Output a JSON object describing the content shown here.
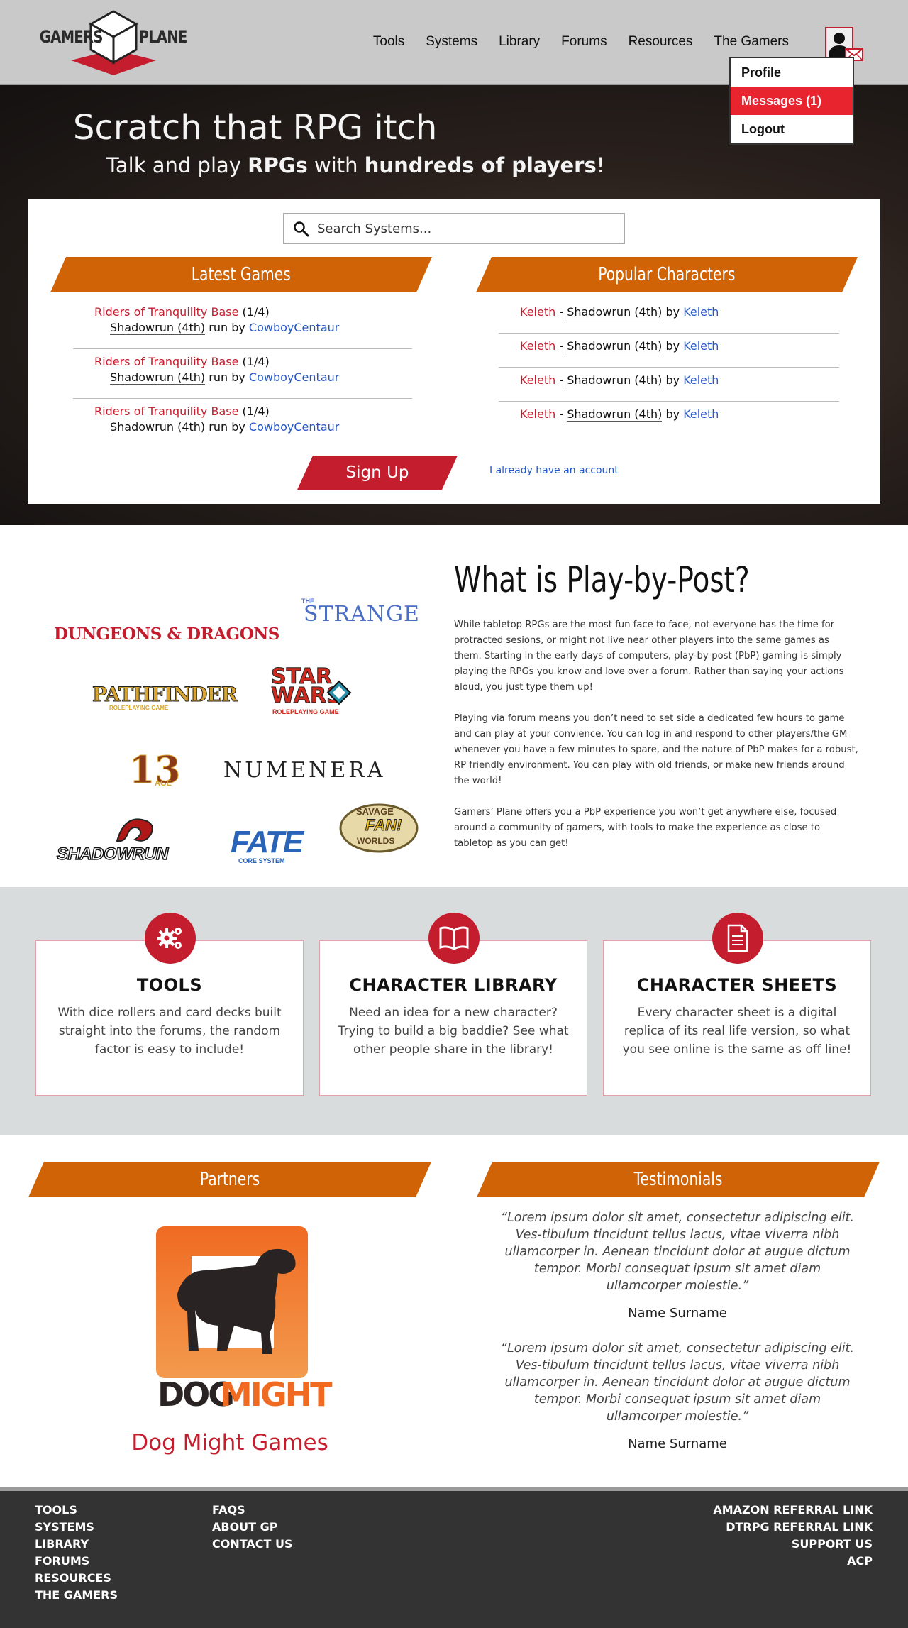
{
  "header": {
    "logo_left": "GAMERS",
    "logo_right": "PLANE",
    "nav": [
      "Tools",
      "Systems",
      "Library",
      "Forums",
      "Resources",
      "The Gamers"
    ],
    "user_menu": [
      "Profile",
      "Messages (1)",
      "Logout"
    ]
  },
  "hero": {
    "title": "Scratch that RPG itch",
    "subtitle_pre": "Talk and play ",
    "subtitle_b1": "RPGs",
    "subtitle_mid": " with ",
    "subtitle_b2": "hundreds of players",
    "subtitle_post": "!",
    "search_placeholder": "Search Systems...",
    "latest_title": "Latest Games",
    "popular_title": "Popular Characters",
    "games": [
      {
        "name": "Riders of Tranquility Base",
        "count": "(1/4)",
        "system": "Shadowrun (4th)",
        "run_by": "run by",
        "gm": "CowboyCentaur"
      },
      {
        "name": "Riders of Tranquility Base",
        "count": "(1/4)",
        "system": "Shadowrun (4th)",
        "run_by": "run by",
        "gm": "CowboyCentaur"
      },
      {
        "name": "Riders of Tranquility Base",
        "count": "(1/4)",
        "system": "Shadowrun (4th)",
        "run_by": "run by",
        "gm": "CowboyCentaur"
      }
    ],
    "characters": [
      {
        "name": "Keleth",
        "sep": "-",
        "system": "Shadowrun (4th)",
        "by": "by",
        "owner": "Keleth"
      },
      {
        "name": "Keleth",
        "sep": "-",
        "system": "Shadowrun (4th)",
        "by": "by",
        "owner": "Keleth"
      },
      {
        "name": "Keleth",
        "sep": "-",
        "system": "Shadowrun (4th)",
        "by": "by",
        "owner": "Keleth"
      },
      {
        "name": "Keleth",
        "sep": "-",
        "system": "Shadowrun (4th)",
        "by": "by",
        "owner": "Keleth"
      }
    ],
    "signup_label": "Sign Up",
    "have_account_label": "I already have an account"
  },
  "logos": {
    "dnd": "DUNGEONS & DRAGONS",
    "strange_small": "THE",
    "strange": "STRANGE",
    "pathfinder": "PATHFINDER",
    "pathfinder_sub": "ROLEPLAYING GAME",
    "starwars": "STAR WARS",
    "starwars_sub": "ROLEPLAYING GAME",
    "age13": "13",
    "age13_sub": "AGE",
    "numenera": "NUMENERA",
    "savage": "SAVAGE",
    "savage_fan": "FAN!",
    "savage_sub": "WORLDS",
    "shadowrun": "SHADOWRUN",
    "fate": "FATE",
    "fate_sub": "CORE SYSTEM"
  },
  "pbp": {
    "title": "What is Play-by-Post?",
    "paragraphs": [
      "While tabletop RPGs are the most fun face to face, not everyone has the time for protracted sesions, or might not live near other players into the same games as them. Starting in the early days of computers, play-by-post (PbP) gaming is simply playing the RPGs you know and love over a forum. Rather than saying your actions aloud, you just type them up!",
      "Playing via forum means you don’t need to set side a dedicated few hours to game and can play at your convience. You can log in and respond to other players/the GM whenever you have a few minutes to spare, and the nature of PbP makes for a robust, RP friendly environment. You can play with old friends, or make new friends around the world!",
      "Gamers’ Plane offers you a PbP experience you won’t get anywhere else, focused around a community of gamers, with tools to make the experience as close to tabletop as you can get!"
    ]
  },
  "features": [
    {
      "icon": "gears-icon",
      "title": "TOOLS",
      "text": "With dice rollers and card decks built straight into the forums, the random factor is easy to include!"
    },
    {
      "icon": "book-icon",
      "title": "CHARACTER LIBRARY",
      "text": "Need an idea for a new character? Trying to build a big baddie? See what other people share in the library!"
    },
    {
      "icon": "document-icon",
      "title": "CHARACTER SHEETS",
      "text": "Every character sheet is a digital replica of its real life version, so what you see online is the same as off line!"
    }
  ],
  "partners": {
    "title": "Partners",
    "logo_dog": "DOG",
    "logo_might": "MIGHT",
    "name": "Dog Might Games"
  },
  "testimonials": {
    "title": "Testimonials",
    "items": [
      {
        "quote": "“Lorem ipsum dolor sit amet, consectetur adipiscing elit. Ves-tibulum tincidunt tellus lacus, vitae viverra nibh ullamcorper in. Aenean tincidunt dolor at augue dictum tempor. Morbi consequat ipsum sit amet diam ullamcorper molestie.”",
        "name": "Name Surname"
      },
      {
        "quote": "“Lorem ipsum dolor sit amet, consectetur adipiscing elit. Ves-tibulum tincidunt tellus lacus, vitae viverra nibh ullamcorper in. Aenean tincidunt dolor at augue dictum tempor. Morbi consequat ipsum sit amet diam ullamcorper molestie.”",
        "name": "Name Surname"
      }
    ]
  },
  "footer": {
    "col1": [
      "TOOLS",
      "SYSTEMS",
      "LIBRARY",
      "FORUMS",
      "RESOURCES",
      "THE GAMERS"
    ],
    "col2": [
      "FAQS",
      "ABOUT GP",
      "CONTACT US"
    ],
    "col3": [
      "AMAZON REFERRAL LINK",
      "DTRPG REFERRAL LINK",
      "SUPPORT US",
      "ACP"
    ]
  },
  "colors": {
    "accent_red": "#c41e2e",
    "banner_orange": "#cf6306",
    "link_blue": "#2456c6",
    "footer_bg": "#333333",
    "features_bg": "#d8dcdc"
  }
}
